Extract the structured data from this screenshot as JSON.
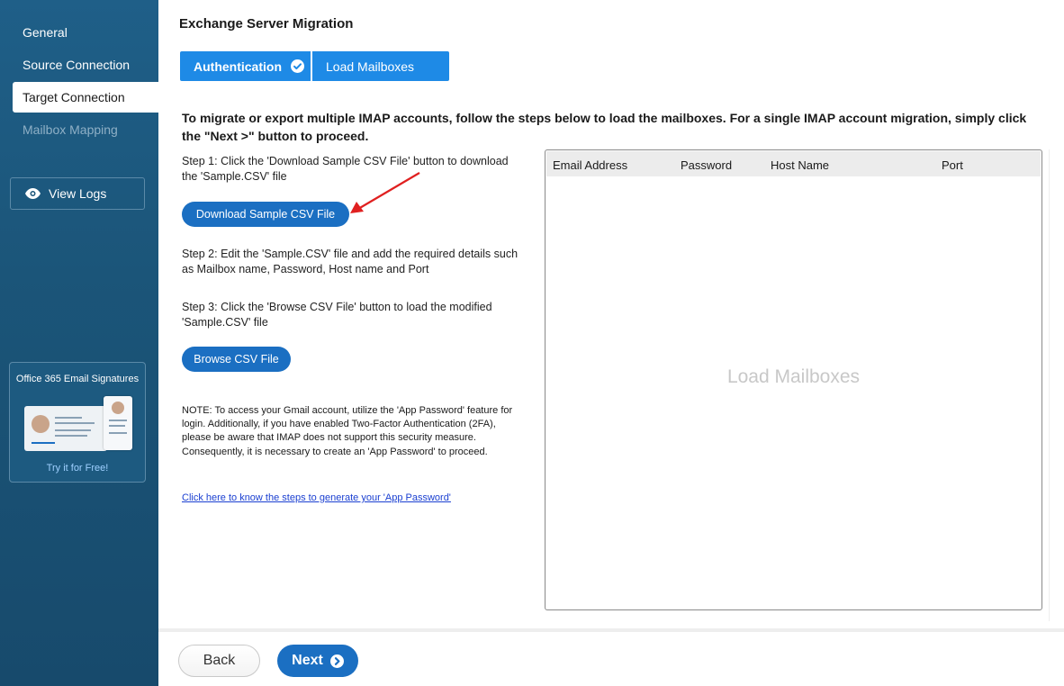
{
  "sidebar": {
    "items": [
      {
        "label": "General",
        "state": "normal"
      },
      {
        "label": "Source Connection",
        "state": "normal"
      },
      {
        "label": "Target Connection",
        "state": "active"
      },
      {
        "label": "Mailbox Mapping",
        "state": "disabled"
      }
    ],
    "view_logs_label": "View Logs",
    "promo": {
      "title": "Office 365 Email Signatures",
      "link": "Try it for Free!"
    }
  },
  "page": {
    "title": "Exchange Server Migration",
    "tabs": [
      {
        "label": "Authentication",
        "completed": true
      },
      {
        "label": "Load Mailboxes",
        "completed": false
      }
    ]
  },
  "content": {
    "intro": "To migrate or export multiple IMAP accounts, follow the steps below to load the mailboxes. For a single IMAP account migration, simply click the \"Next >\" button to proceed.",
    "step1": "Step 1: Click the 'Download Sample CSV File' button to download the 'Sample.CSV' file",
    "download_button": "Download Sample CSV File",
    "step2": "Step 2: Edit the 'Sample.CSV' file and add the required details such as Mailbox name, Password, Host name and Port",
    "step3": "Step 3: Click the 'Browse CSV File' button to load the modified 'Sample.CSV' file",
    "browse_button": "Browse CSV File",
    "note": "NOTE: To access your Gmail account, utilize the 'App Password' feature for login. Additionally, if you have enabled Two-Factor Authentication (2FA), please be aware that IMAP does not support this security measure. Consequently, it is necessary to create an 'App Password' to proceed.",
    "help_link": "Click here to know the steps to generate your 'App Password'"
  },
  "grid": {
    "columns": [
      "Email Address",
      "Password",
      "Host Name",
      "Port"
    ],
    "placeholder": "Load Mailboxes",
    "rows": []
  },
  "footer": {
    "back_label": "Back",
    "next_label": "Next"
  },
  "colors": {
    "sidebar_bg": "#1b5579",
    "tab_blue": "#1e8ae6",
    "button_blue": "#1b6fc2",
    "annotation_arrow": "#e02020"
  }
}
